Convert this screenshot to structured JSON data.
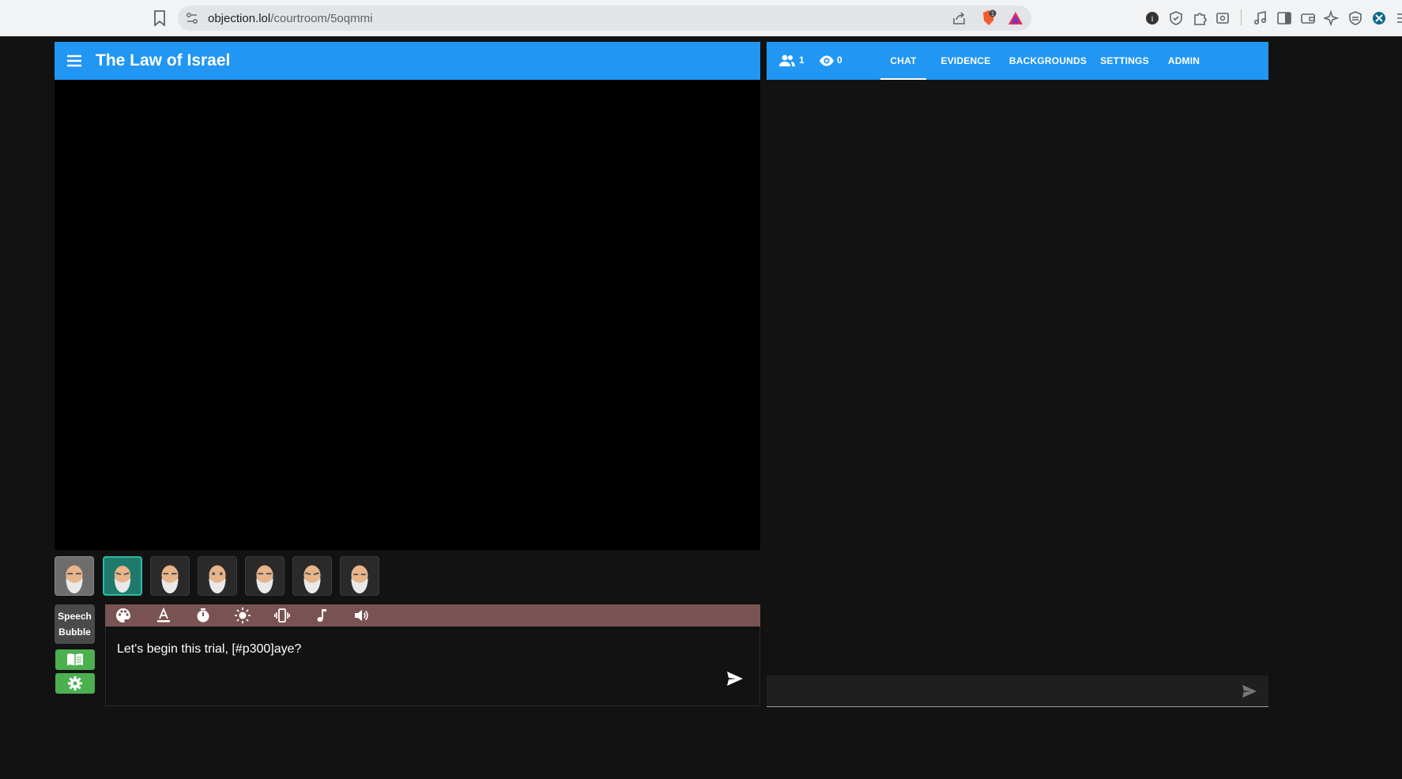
{
  "browser": {
    "url_host": "objection.lol",
    "url_path": "/courtroom/5oqmmi",
    "brave_badge": "1",
    "extension_icons": [
      "info-icon",
      "shield-check-icon",
      "puzzle-icon",
      "screenshot-icon",
      "music-icon",
      "sidebar-icon",
      "wallet-icon",
      "sparkle-icon",
      "vpn-icon",
      "cross-icon",
      "more-icon"
    ]
  },
  "courtroom": {
    "title": "The Law of Israel",
    "poses": [
      "pose-1",
      "pose-2",
      "pose-3",
      "pose-4",
      "pose-5",
      "pose-6",
      "pose-7"
    ],
    "selected_pose": 1,
    "speech_bubble_line1": "Speech",
    "speech_bubble_line2": "Bubble",
    "toolbar_icons": [
      "palette-icon",
      "text-color-icon",
      "timer-icon",
      "brightness-icon",
      "vibrate-icon",
      "music-note-icon",
      "volume-icon"
    ],
    "message": "Let's begin this trial, [#p300]aye?"
  },
  "side_panel": {
    "users_count": "1",
    "viewers_count": "0",
    "tabs": [
      {
        "label": "CHAT",
        "active": true
      },
      {
        "label": "EVIDENCE",
        "active": false
      },
      {
        "label": "BACKGROUNDS",
        "active": false
      },
      {
        "label": "SETTINGS",
        "active": false
      },
      {
        "label": "ADMIN",
        "active": false
      }
    ],
    "chat_placeholder": ""
  },
  "colors": {
    "appbar": "#2196f3",
    "toolbar": "#795353",
    "green_button": "#4caf50",
    "selected_pose": "#1f7a6c",
    "background": "#121212"
  }
}
